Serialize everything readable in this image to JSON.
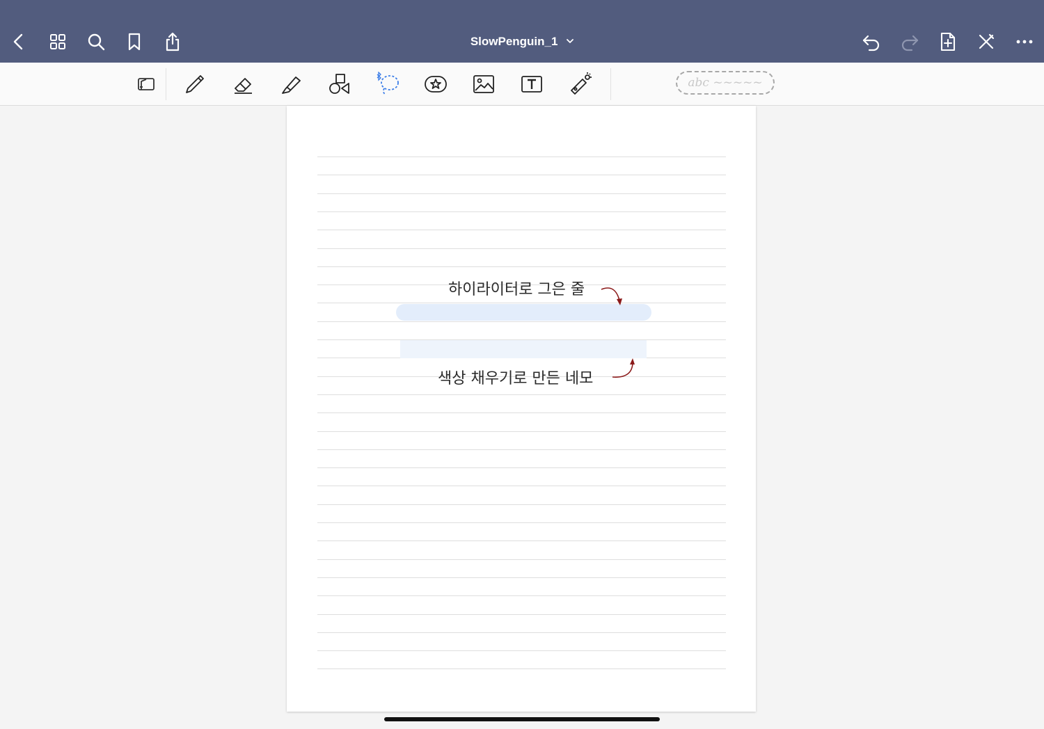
{
  "header": {
    "title": "SlowPenguin_1",
    "background": "#525c7e",
    "left_icons": [
      "back-icon",
      "grid-icon",
      "search-icon",
      "bookmark-icon",
      "share-icon"
    ],
    "right_icons": [
      "undo-icon",
      "redo-icon",
      "add-page-icon",
      "close-x-icon",
      "more-icon"
    ]
  },
  "toolbar": {
    "tools": [
      "read-mode-icon",
      "pen-icon",
      "eraser-icon",
      "highlighter-icon",
      "shapes-icon",
      "lasso-icon",
      "sticker-icon",
      "image-icon",
      "text-icon",
      "laser-pointer-icon"
    ],
    "active_tool": "lasso-icon",
    "accent": "#3b7de8",
    "pen_preview_text": "abc ~~~~~"
  },
  "page": {
    "annotations": {
      "highlighter_label": "하이라이터로 그은 줄",
      "fill_label": "색상 채우기로 만든 네모"
    },
    "highlight_color": "#e3edfb",
    "fill_color": "#eef4fc",
    "arrow_color": "#8b1a1a"
  }
}
